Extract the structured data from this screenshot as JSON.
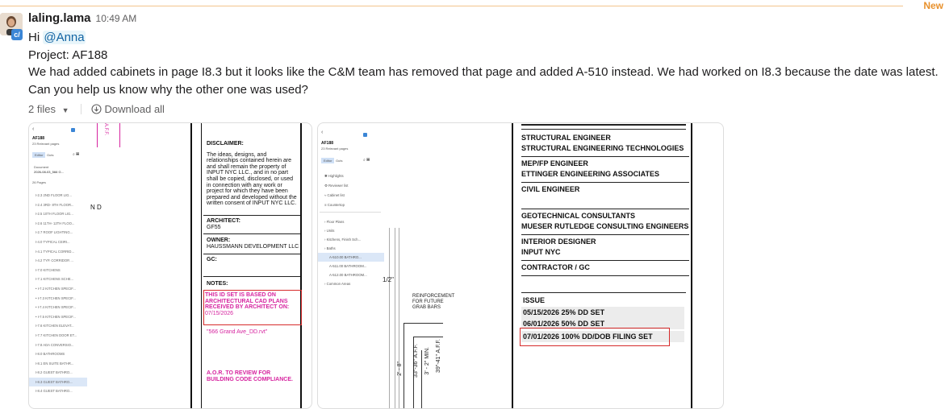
{
  "new_marker": "New",
  "message": {
    "author": "laling.lama",
    "time": "10:49 AM",
    "badge": "c/",
    "greeting": "Hi",
    "mention": "@Anna",
    "project_line": "Project: AF188",
    "body_line1": "We had added cabinets in page I8.3 but it looks like the C&M team has removed that page and added A-510 instead. We had worked on I8.3 because the date was latest.",
    "body_line2": "Can you help us know why the other one was used?"
  },
  "files": {
    "count_label": "2 files",
    "download_label": "Download all"
  },
  "thumb1": {
    "sidebar": {
      "title": "AF188",
      "subtitle": "23 Relevant pages",
      "tab_editor": "Editor",
      "tab_guts": "Guts",
      "document_label": "Document",
      "document_value": "2026-08-03_566 G...",
      "pages_label": "26 Pages",
      "pages": [
        "I-2.3 2ND FLOOR LIG...",
        "I-2.4 3RD- 8TH FLOOR...",
        "I-2.5 10TH FLOOR LIG...",
        "I-2.6 11TH- 12TH FLOO...",
        "I-2.7 ROOF LIGHTING...",
        "I-4.0 TYPICAL CEIRI...",
        "I-4.1 TYPICAL CORRID...",
        "I-4.2 TYP. CORRIDOR ...",
        "I-7.0 KITCHENS",
        "I-7.1 KITCHENS SCHE...",
        "I-7.2 KITCHEN SPECIF...",
        "I-7.3 KITCHEN SPECIF...",
        "I-7.4 KITCHEN SPECIF...",
        "I-7.5 KITCHEN SPECIF...",
        "I-7.6 KITCHEN ELEVAT...",
        "I-7.7 KITCHEN DOOR ET...",
        "I-7.8 ADA CONVERSIO...",
        "I-8.0 BATHROOMS",
        "I-8.1 EN SUITE BATHR...",
        "I-8.2 GUEST BATHRO...",
        "I-8.3 GUEST BATHRO...",
        "I-8.4 GUEST BATHRO..."
      ]
    },
    "plan_label": "N D",
    "aff_label": "A.F.F.",
    "disclaimer_title": "DISCLAIMER:",
    "disclaimer_text": "The ideas, designs, and relationships contained herein are and shall remain the property of INPUT NYC LLC., and in no part shall be copied, disclosed, or used in connection with any work or project for which they have been prepared and developed without the written consent of INPUT NYC LLC.",
    "architect_label": "ARCHITECT:",
    "architect_value": "GF55",
    "owner_label": "OWNER:",
    "owner_value": "HAUSSMANN DEVELOPMENT LLC",
    "gc_label": "GC:",
    "notes_label": "NOTES:",
    "note_red": "THIS ID SET IS BASED ON ARCHITECTURAL CAD PLANS RECEIVED BY ARCHITECT ON:",
    "note_date": "07/15/2026",
    "note_file": "\"566 Grand Ave_DD.rvt\"",
    "aor_note": "A.O.R. TO REVIEW FOR BUILDING CODE COMPLIANCE."
  },
  "thumb2": {
    "sidebar": {
      "title": "AF188",
      "subtitle": "23 Relevant pages",
      "tab_editor": "Editor",
      "tab_guts": "Guts",
      "menu": [
        "Highlights",
        "Reviewer list",
        "Cabinet list",
        "Countertop"
      ],
      "tree": [
        "Floor Plans",
        "Units",
        "Kitchens, Finish Sch...",
        "Baths",
        "A-510.00 BATHRO...",
        "A-511.00 BATHROOM...",
        "A-512.00 BATHROOM...",
        "Common Areas"
      ]
    },
    "reinforcement": "REINFORCEMENT FOR FUTURE GRAB BARS",
    "dims": [
      "2' - 8\"",
      "33\"-36\" A.F.F.",
      "3' - 2\" MIN.",
      "39\"-41\" A.F.F."
    ],
    "dim_fraction": "1/2\"",
    "consultants": [
      {
        "role": "STRUCTURAL ENGINEER",
        "name": "STRUCTURAL ENGINEERING TECHNOLOGIES"
      },
      {
        "role": "MEP/FP ENGINEER",
        "name": "ETTINGER ENGINEERING ASSOCIATES"
      },
      {
        "role": "CIVIL ENGINEER",
        "name": ""
      },
      {
        "role": "GEOTECHNICAL CONSULTANTS",
        "name": "MUESER RUTLEDGE CONSULTING ENGINEERS"
      },
      {
        "role": "INTERIOR DESIGNER",
        "name": "INPUT NYC"
      },
      {
        "role": "CONTRACTOR / GC",
        "name": ""
      }
    ],
    "issue_label": "ISSUE",
    "issues": [
      {
        "date": "05/15/2026",
        "desc": "25% DD SET"
      },
      {
        "date": "06/01/2026",
        "desc": "50% DD SET"
      },
      {
        "date": "07/01/2026",
        "desc": "100% DD/DOB FILING SET"
      }
    ]
  }
}
